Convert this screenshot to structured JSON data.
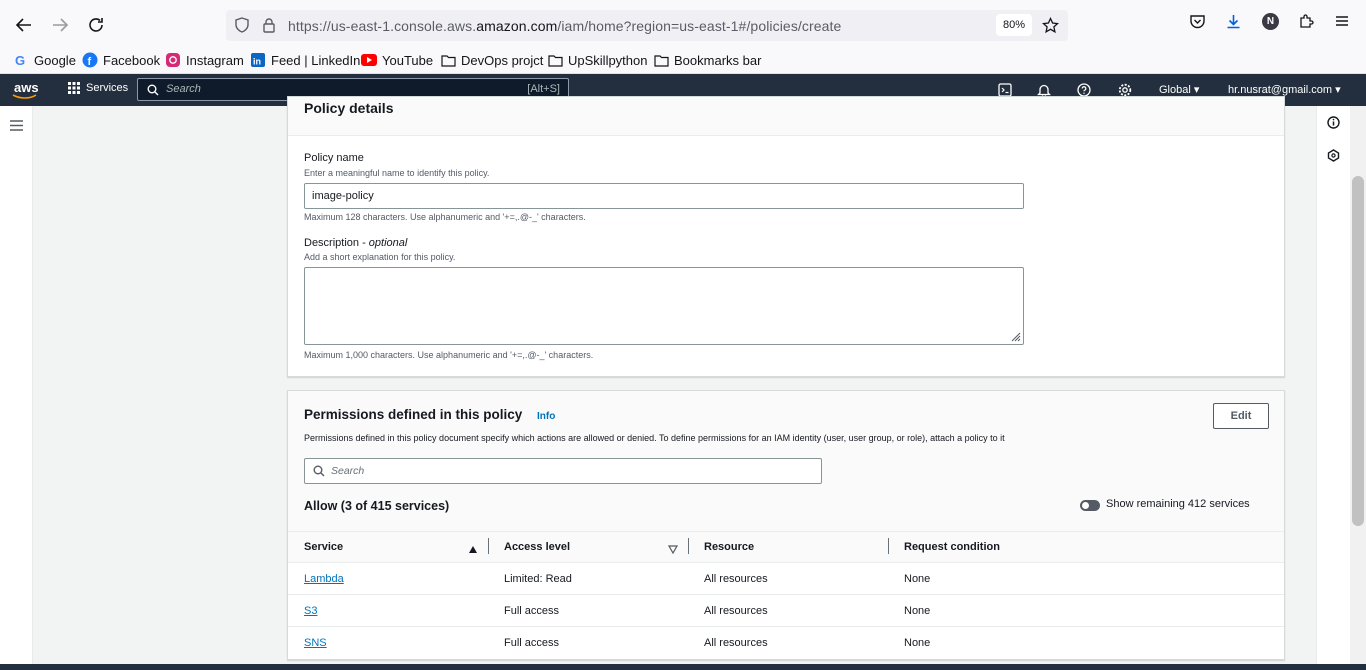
{
  "browser": {
    "url_prefix": "https://us-east-1.console.aws.",
    "url_domain": "amazon.com",
    "url_path": "/iam/home?region=us-east-1#/policies/create",
    "zoom": "80%",
    "profile_initial": "N"
  },
  "bookmarks": [
    {
      "label": "Google",
      "icon": "google-icon"
    },
    {
      "label": "Facebook",
      "icon": "facebook-icon"
    },
    {
      "label": "Instagram",
      "icon": "instagram-icon"
    },
    {
      "label": "Feed | LinkedIn",
      "icon": "linkedin-icon"
    },
    {
      "label": "YouTube",
      "icon": "youtube-icon"
    },
    {
      "label": "DevOps projct",
      "icon": "folder-icon"
    },
    {
      "label": "UpSkillpython",
      "icon": "folder-icon"
    },
    {
      "label": "Bookmarks bar",
      "icon": "folder-icon"
    }
  ],
  "aws_nav": {
    "logo": "aws",
    "services_label": "Services",
    "search_placeholder": "Search",
    "search_shortcut": "[Alt+S]",
    "region": "Global",
    "account": "hr.nusrat@gmail.com"
  },
  "policy_details": {
    "title": "Policy details",
    "name_label": "Policy name",
    "name_hint": "Enter a meaningful name to identify this policy.",
    "name_value": "image-policy",
    "name_constraint": "Maximum 128 characters. Use alphanumeric and '+=,.@-_' characters.",
    "description_label": "Description - ",
    "description_optional": "optional",
    "description_hint": "Add a short explanation for this policy.",
    "description_value": "",
    "description_constraint": "Maximum 1,000 characters. Use alphanumeric and '+=,.@-_' characters."
  },
  "permissions": {
    "title": "Permissions defined in this policy",
    "info_label": "Info",
    "edit_label": "Edit",
    "description": "Permissions defined in this policy document specify which actions are allowed or denied. To define permissions for an IAM identity (user, user group, or role), attach a policy to it",
    "search_placeholder": "Search",
    "allow_heading": "Allow (3 of 415 services)",
    "toggle_label": "Show remaining 412 services",
    "columns": [
      "Service",
      "Access level",
      "Resource",
      "Request condition"
    ],
    "rows": [
      {
        "service": "Lambda",
        "access": "Limited: Read",
        "resource": "All resources",
        "condition": "None"
      },
      {
        "service": "S3",
        "access": "Full access",
        "resource": "All resources",
        "condition": "None"
      },
      {
        "service": "SNS",
        "access": "Full access",
        "resource": "All resources",
        "condition": "None"
      }
    ]
  },
  "colors": {
    "aws_nav": "#232f3e",
    "link": "#0073bb",
    "page_bg": "#f2f3f3"
  }
}
